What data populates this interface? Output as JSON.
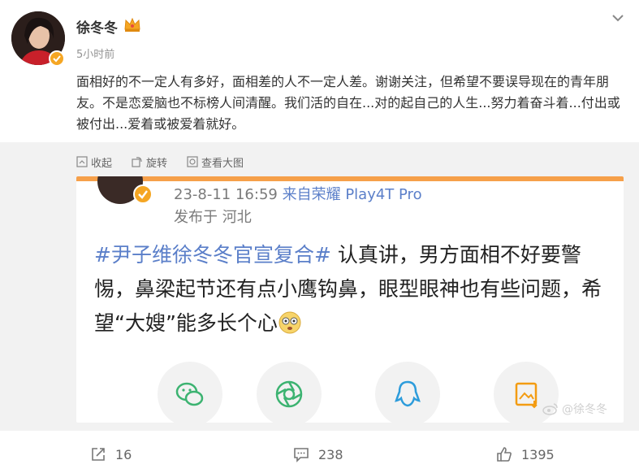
{
  "post": {
    "username": "徐冬冬",
    "time": "5小时前",
    "text": "面相好的不一定人有多好，面相差的人不一定人差。谢谢关注，但希望不要误导现在的青年朋友。不是恋爱脑也不标榜人间清醒。我们活的自在...对的起自己的人生...努力着奋斗着...付出或被付出...爱着或被爱着就好。"
  },
  "media_toolbar": {
    "collapse_label": "收起",
    "rotate_label": "旋转",
    "view_large_label": "查看大图"
  },
  "embedded_image": {
    "meta_time": "23-8-11 16:59",
    "meta_source": "来自荣耀 Play4T Pro",
    "meta_location": "发布于 河北",
    "hashtag": "#尹子维徐冬冬官宣复合#",
    "body_text": " 认真讲，男方面相不好要警惕，鼻梁起节还有点小鹰钩鼻，眼型眼神也有些问题，希望“大嫂”能多长个心",
    "watermark": "@徐冬冬",
    "share_icons": [
      "wechat-icon",
      "moments-icon",
      "qq-icon",
      "save-image-icon"
    ]
  },
  "actions": {
    "repost_count": "16",
    "comment_count": "238",
    "like_count": "1395"
  },
  "colors": {
    "accent_orange": "#f6a04a",
    "verified_gold": "#f5a623",
    "link_blue": "#5b7fc9",
    "muted_text": "#939393"
  }
}
